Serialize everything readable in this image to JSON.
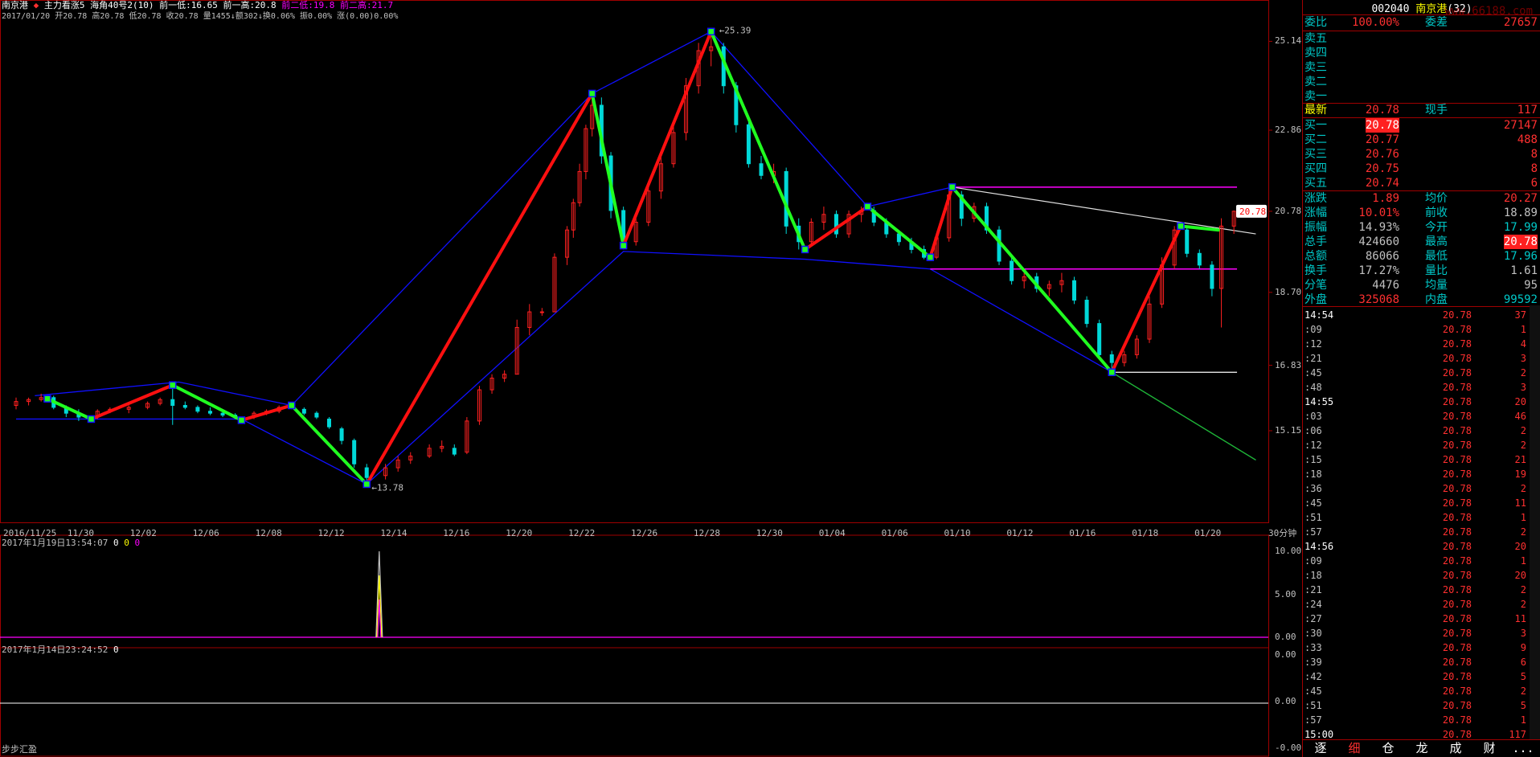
{
  "header": {
    "stock_name": "南京港",
    "indicator_line": "主力看涨5 海角40号2(10) 前一低:16.65 前一高:20.8",
    "prev_low2": "前二低:19.8",
    "prev_high2": "前二高:21.7",
    "ohlc_line": "2017/01/20 开20.78 高20.78 低20.78 收20.78 量1455↓额302↓换0.06% 振0.00% 涨(0.00)0.00%"
  },
  "chart_data": {
    "type": "line",
    "title": "",
    "period_label": "30分钟",
    "x_labels": [
      "2016/11/25",
      "11/30",
      "12/02",
      "12/06",
      "12/08",
      "12/12",
      "12/14",
      "12/16",
      "12/20",
      "12/22",
      "12/26",
      "12/28",
      "12/30",
      "01/04",
      "01/06",
      "01/10",
      "01/12",
      "01/16",
      "01/18",
      "01/20"
    ],
    "price_ticks": [
      "25.14",
      "22.86",
      "20.78",
      "18.70",
      "16.83",
      "15.15"
    ],
    "ylim": [
      12.8,
      26.2
    ],
    "price_tag": "20.78",
    "high_label": "25.39",
    "low_label": "13.78",
    "zigzag_points": [
      {
        "i": 0.5,
        "p": 15.97
      },
      {
        "i": 1.2,
        "p": 15.45
      },
      {
        "i": 2.5,
        "p": 16.32
      },
      {
        "i": 3.6,
        "p": 15.42
      },
      {
        "i": 4.4,
        "p": 15.8
      },
      {
        "i": 5.6,
        "p": 13.78
      },
      {
        "i": 9.2,
        "p": 23.8
      },
      {
        "i": 9.7,
        "p": 19.9
      },
      {
        "i": 11.1,
        "p": 25.39
      },
      {
        "i": 12.6,
        "p": 19.8
      },
      {
        "i": 13.6,
        "p": 20.9
      },
      {
        "i": 14.6,
        "p": 19.6
      },
      {
        "i": 14.95,
        "p": 21.4
      },
      {
        "i": 17.5,
        "p": 16.65
      },
      {
        "i": 18.6,
        "p": 20.4
      },
      {
        "i": 19.2,
        "p": 20.3
      }
    ],
    "upper_envelope": [
      {
        "i": 0.3,
        "p": 16.05
      },
      {
        "i": 2.6,
        "p": 16.4
      },
      {
        "i": 4.4,
        "p": 15.8
      },
      {
        "i": 9.2,
        "p": 23.8
      },
      {
        "i": 11.1,
        "p": 25.39
      },
      {
        "i": 13.6,
        "p": 20.9
      },
      {
        "i": 14.95,
        "p": 21.4
      }
    ],
    "lower_envelope": [
      {
        "i": 0,
        "p": 15.45
      },
      {
        "i": 3.6,
        "p": 15.45
      },
      {
        "i": 5.6,
        "p": 13.78
      },
      {
        "i": 9.7,
        "p": 19.75
      },
      {
        "i": 12.6,
        "p": 19.55
      },
      {
        "i": 14.6,
        "p": 19.3
      },
      {
        "i": 17.5,
        "p": 16.65
      },
      {
        "i": 19.8,
        "p": 14.4
      }
    ],
    "magenta_upper": {
      "from_i": 14.95,
      "to_i": 19.5,
      "p": 21.4
    },
    "magenta_lower": {
      "from_i": 14.6,
      "to_i": 19.5,
      "p": 19.3
    },
    "white_trend": {
      "from_i": 14.95,
      "from_p": 21.4,
      "to_i": 19.8,
      "to_p": 20.2
    },
    "white_support": {
      "from_i": 17.5,
      "to_i": 19.5,
      "p": 16.65
    },
    "candles": [
      [
        0.0,
        15.8,
        16.0,
        15.7,
        15.9
      ],
      [
        0.2,
        15.9,
        16.0,
        15.8,
        15.95
      ],
      [
        0.4,
        15.95,
        16.1,
        15.9,
        16.0
      ],
      [
        0.6,
        16.0,
        16.05,
        15.7,
        15.75
      ],
      [
        0.8,
        15.75,
        15.8,
        15.5,
        15.6
      ],
      [
        1.0,
        15.6,
        15.7,
        15.4,
        15.5
      ],
      [
        1.3,
        15.5,
        15.7,
        15.45,
        15.65
      ],
      [
        1.5,
        15.65,
        15.75,
        15.6,
        15.7
      ],
      [
        1.8,
        15.7,
        15.8,
        15.6,
        15.75
      ],
      [
        2.1,
        15.75,
        15.9,
        15.7,
        15.85
      ],
      [
        2.3,
        15.85,
        16.0,
        15.8,
        15.95
      ],
      [
        2.5,
        15.95,
        16.3,
        15.3,
        15.8
      ],
      [
        2.7,
        15.8,
        15.9,
        15.7,
        15.75
      ],
      [
        2.9,
        15.75,
        15.8,
        15.6,
        15.65
      ],
      [
        3.1,
        15.65,
        15.75,
        15.55,
        15.6
      ],
      [
        3.3,
        15.6,
        15.65,
        15.5,
        15.55
      ],
      [
        3.5,
        15.55,
        15.6,
        15.45,
        15.5
      ],
      [
        3.8,
        15.5,
        15.65,
        15.45,
        15.6
      ],
      [
        4.0,
        15.6,
        15.7,
        15.55,
        15.65
      ],
      [
        4.2,
        15.65,
        15.8,
        15.6,
        15.75
      ],
      [
        4.4,
        15.75,
        15.85,
        15.7,
        15.8
      ],
      [
        4.6,
        15.7,
        15.75,
        15.55,
        15.6
      ],
      [
        4.8,
        15.6,
        15.65,
        15.45,
        15.5
      ],
      [
        5.0,
        15.45,
        15.5,
        15.2,
        15.25
      ],
      [
        5.2,
        15.2,
        15.25,
        14.8,
        14.9
      ],
      [
        5.4,
        14.9,
        14.95,
        14.2,
        14.3
      ],
      [
        5.6,
        14.2,
        14.3,
        13.78,
        13.95
      ],
      [
        5.9,
        14.0,
        14.3,
        13.9,
        14.2
      ],
      [
        6.1,
        14.2,
        14.5,
        14.1,
        14.4
      ],
      [
        6.3,
        14.4,
        14.6,
        14.3,
        14.5
      ],
      [
        6.6,
        14.5,
        14.8,
        14.45,
        14.7
      ],
      [
        6.8,
        14.7,
        14.9,
        14.6,
        14.75
      ],
      [
        7.0,
        14.7,
        14.8,
        14.5,
        14.55
      ],
      [
        7.2,
        14.6,
        15.5,
        14.55,
        15.4
      ],
      [
        7.4,
        15.4,
        16.3,
        15.3,
        16.2
      ],
      [
        7.6,
        16.2,
        16.6,
        16.1,
        16.5
      ],
      [
        7.8,
        16.5,
        16.7,
        16.4,
        16.6
      ],
      [
        8.0,
        16.6,
        18.0,
        16.6,
        17.8
      ],
      [
        8.2,
        17.8,
        18.4,
        17.6,
        18.2
      ],
      [
        8.4,
        18.2,
        18.3,
        18.1,
        18.2
      ],
      [
        8.6,
        18.2,
        19.7,
        18.2,
        19.6
      ],
      [
        8.8,
        19.6,
        20.4,
        19.4,
        20.3
      ],
      [
        8.9,
        20.3,
        21.1,
        20.1,
        21.0
      ],
      [
        9.0,
        21.0,
        22.0,
        20.9,
        21.8
      ],
      [
        9.1,
        21.8,
        23.0,
        21.6,
        22.9
      ],
      [
        9.2,
        22.9,
        23.8,
        22.7,
        23.5
      ],
      [
        9.35,
        23.5,
        23.7,
        22.0,
        22.2
      ],
      [
        9.5,
        22.2,
        22.3,
        20.6,
        20.8
      ],
      [
        9.7,
        20.8,
        20.9,
        19.8,
        20.0
      ],
      [
        9.9,
        20.0,
        20.6,
        19.9,
        20.5
      ],
      [
        10.1,
        20.5,
        21.4,
        20.4,
        21.3
      ],
      [
        10.3,
        21.3,
        22.2,
        21.1,
        22.0
      ],
      [
        10.5,
        22.0,
        23.0,
        21.9,
        22.8
      ],
      [
        10.7,
        22.8,
        24.2,
        22.6,
        24.0
      ],
      [
        10.9,
        24.0,
        25.1,
        23.8,
        24.9
      ],
      [
        11.1,
        24.9,
        25.39,
        24.5,
        25.0
      ],
      [
        11.3,
        25.0,
        25.1,
        23.8,
        24.0
      ],
      [
        11.5,
        24.0,
        24.1,
        22.8,
        23.0
      ],
      [
        11.7,
        23.0,
        23.2,
        21.9,
        22.0
      ],
      [
        11.9,
        22.0,
        22.2,
        21.6,
        21.7
      ],
      [
        12.1,
        21.7,
        22.0,
        21.5,
        21.8
      ],
      [
        12.3,
        21.8,
        21.9,
        20.2,
        20.4
      ],
      [
        12.5,
        20.4,
        20.6,
        19.8,
        20.0
      ],
      [
        12.7,
        20.0,
        20.6,
        19.9,
        20.5
      ],
      [
        12.9,
        20.5,
        20.9,
        20.3,
        20.7
      ],
      [
        13.1,
        20.7,
        20.8,
        20.1,
        20.2
      ],
      [
        13.3,
        20.2,
        20.8,
        20.1,
        20.7
      ],
      [
        13.5,
        20.7,
        20.9,
        20.5,
        20.8
      ],
      [
        13.7,
        20.8,
        20.9,
        20.4,
        20.5
      ],
      [
        13.9,
        20.5,
        20.6,
        20.1,
        20.2
      ],
      [
        14.1,
        20.2,
        20.3,
        19.9,
        20.0
      ],
      [
        14.3,
        20.0,
        20.1,
        19.7,
        19.8
      ],
      [
        14.5,
        19.8,
        19.9,
        19.55,
        19.6
      ],
      [
        14.7,
        19.6,
        20.2,
        19.55,
        20.1
      ],
      [
        14.9,
        20.1,
        21.4,
        20.0,
        21.2
      ],
      [
        15.1,
        21.2,
        21.3,
        20.4,
        20.6
      ],
      [
        15.3,
        20.6,
        21.0,
        20.5,
        20.9
      ],
      [
        15.5,
        20.9,
        21.0,
        20.2,
        20.3
      ],
      [
        15.7,
        20.3,
        20.4,
        19.4,
        19.5
      ],
      [
        15.9,
        19.5,
        19.6,
        18.9,
        19.0
      ],
      [
        16.1,
        19.0,
        19.2,
        18.8,
        19.1
      ],
      [
        16.3,
        19.1,
        19.2,
        18.7,
        18.8
      ],
      [
        16.5,
        18.8,
        19.0,
        18.6,
        18.9
      ],
      [
        16.7,
        18.9,
        19.2,
        18.7,
        19.0
      ],
      [
        16.9,
        19.0,
        19.1,
        18.4,
        18.5
      ],
      [
        17.1,
        18.5,
        18.6,
        17.8,
        17.9
      ],
      [
        17.3,
        17.9,
        18.0,
        17.0,
        17.1
      ],
      [
        17.5,
        17.1,
        17.2,
        16.65,
        16.9
      ],
      [
        17.7,
        16.9,
        17.2,
        16.8,
        17.1
      ],
      [
        17.9,
        17.1,
        17.6,
        17.0,
        17.5
      ],
      [
        18.1,
        17.5,
        18.6,
        17.4,
        18.4
      ],
      [
        18.3,
        18.4,
        19.6,
        18.3,
        19.4
      ],
      [
        18.5,
        19.4,
        20.4,
        19.3,
        20.3
      ],
      [
        18.7,
        20.3,
        20.4,
        19.6,
        19.7
      ],
      [
        18.9,
        19.7,
        19.8,
        19.3,
        19.4
      ],
      [
        19.1,
        19.4,
        19.5,
        18.6,
        18.8
      ],
      [
        19.25,
        18.8,
        20.6,
        17.8,
        20.4
      ],
      [
        19.45,
        20.4,
        20.8,
        20.2,
        20.78
      ]
    ],
    "macd_date": "2017年1月19日13:54:07",
    "macd_vals": [
      "0",
      "0",
      "0"
    ],
    "macd_ticks": [
      "10.00",
      "5.00",
      "0.00"
    ],
    "lower_date": "2017年1月14日23:24:52",
    "lower_val": "0",
    "lower_ticks": [
      "0.00",
      "0.00",
      "-0.00"
    ],
    "footer_label": "步步汇盈"
  },
  "panel": {
    "code": "002040",
    "name": "南京港",
    "count": "(32)",
    "watermark": "www.66188.com",
    "ratio_label": "委比",
    "ratio_value": "100.00%",
    "diff_label": "委差",
    "diff_value": "27657",
    "asks": [
      {
        "label": "卖五"
      },
      {
        "label": "卖四"
      },
      {
        "label": "卖三"
      },
      {
        "label": "卖二"
      },
      {
        "label": "卖一"
      }
    ],
    "latest": {
      "label": "最新",
      "price": "20.78",
      "label2": "现手",
      "value": "117"
    },
    "bids": [
      {
        "label": "买一",
        "price": "20.78",
        "vol": "27147"
      },
      {
        "label": "买二",
        "price": "20.77",
        "vol": "488"
      },
      {
        "label": "买三",
        "price": "20.76",
        "vol": "8"
      },
      {
        "label": "买四",
        "price": "20.75",
        "vol": "8"
      },
      {
        "label": "买五",
        "price": "20.74",
        "vol": "6"
      }
    ],
    "stats": [
      {
        "l1": "涨跌",
        "v1": "1.89",
        "l2": "均价",
        "v2": "20.27",
        "c1": "#ff3030",
        "c2": "#ff3030"
      },
      {
        "l1": "涨幅",
        "v1": "10.01%",
        "l2": "前收",
        "v2": "18.89",
        "c1": "#ff3030",
        "c2": "#c0c0c0"
      },
      {
        "l1": "振幅",
        "v1": "14.93%",
        "l2": "今开",
        "v2": "17.99",
        "c1": "#c0c0c0",
        "c2": "#00c8c8"
      },
      {
        "l1": "总手",
        "v1": "424660",
        "l2": "最高",
        "v2": "20.78",
        "c1": "#c0c0c0",
        "c2": "#ffffff"
      },
      {
        "l1": "总额",
        "v1": "86066",
        "l2": "最低",
        "v2": "17.96",
        "c1": "#c0c0c0",
        "c2": "#00c8c8"
      },
      {
        "l1": "换手",
        "v1": "17.27%",
        "l2": "量比",
        "v2": "1.61",
        "c1": "#c0c0c0",
        "c2": "#c0c0c0"
      },
      {
        "l1": "分笔",
        "v1": "4476",
        "l2": "均量",
        "v2": "95",
        "c1": "#c0c0c0",
        "c2": "#c0c0c0"
      },
      {
        "l1": "外盘",
        "v1": "325068",
        "l2": "内盘",
        "v2": "99592",
        "c1": "#ff3030",
        "c2": "#00c8c8"
      }
    ],
    "ticks": [
      {
        "t": "14:54",
        "p": "20.78",
        "v": "37"
      },
      {
        "t": ":09",
        "p": "20.78",
        "v": "1"
      },
      {
        "t": ":12",
        "p": "20.78",
        "v": "4"
      },
      {
        "t": ":21",
        "p": "20.78",
        "v": "3"
      },
      {
        "t": ":45",
        "p": "20.78",
        "v": "2"
      },
      {
        "t": ":48",
        "p": "20.78",
        "v": "3"
      },
      {
        "t": "14:55",
        "p": "20.78",
        "v": "20"
      },
      {
        "t": ":03",
        "p": "20.78",
        "v": "46"
      },
      {
        "t": ":06",
        "p": "20.78",
        "v": "2"
      },
      {
        "t": ":12",
        "p": "20.78",
        "v": "2"
      },
      {
        "t": ":15",
        "p": "20.78",
        "v": "21"
      },
      {
        "t": ":18",
        "p": "20.78",
        "v": "19"
      },
      {
        "t": ":36",
        "p": "20.78",
        "v": "2"
      },
      {
        "t": ":45",
        "p": "20.78",
        "v": "11"
      },
      {
        "t": ":51",
        "p": "20.78",
        "v": "1"
      },
      {
        "t": ":57",
        "p": "20.78",
        "v": "2"
      },
      {
        "t": "14:56",
        "p": "20.78",
        "v": "20"
      },
      {
        "t": ":09",
        "p": "20.78",
        "v": "1"
      },
      {
        "t": ":18",
        "p": "20.78",
        "v": "20"
      },
      {
        "t": ":21",
        "p": "20.78",
        "v": "2"
      },
      {
        "t": ":24",
        "p": "20.78",
        "v": "2"
      },
      {
        "t": ":27",
        "p": "20.78",
        "v": "11"
      },
      {
        "t": ":30",
        "p": "20.78",
        "v": "3"
      },
      {
        "t": ":33",
        "p": "20.78",
        "v": "9"
      },
      {
        "t": ":39",
        "p": "20.78",
        "v": "6"
      },
      {
        "t": ":42",
        "p": "20.78",
        "v": "5"
      },
      {
        "t": ":45",
        "p": "20.78",
        "v": "2"
      },
      {
        "t": ":51",
        "p": "20.78",
        "v": "5"
      },
      {
        "t": ":57",
        "p": "20.78",
        "v": "1"
      },
      {
        "t": "15:00",
        "p": "20.78",
        "v": "117"
      }
    ],
    "tabs": [
      "逐",
      "细",
      "仓",
      "龙",
      "成",
      "财",
      "..."
    ]
  },
  "colors": {
    "up": "#ff2020",
    "down": "#00d8d8",
    "zig_up": "#ff1010",
    "zig_down": "#20ff20",
    "envelope": "#1010ff",
    "magenta": "#ff00ff",
    "frame": "#a00000"
  }
}
